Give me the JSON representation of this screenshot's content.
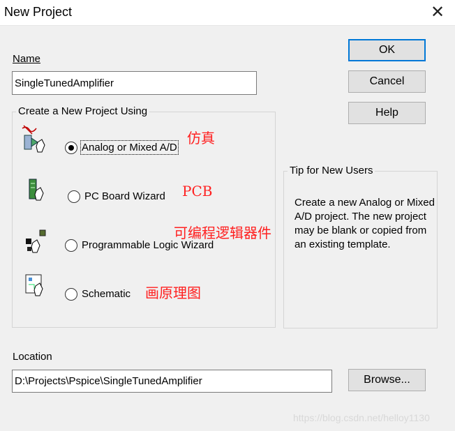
{
  "window": {
    "title": "New Project",
    "close_glyph": "✕"
  },
  "name": {
    "label": "Name",
    "value": "SingleTunedAmplifier"
  },
  "buttons": {
    "ok": "OK",
    "cancel": "Cancel",
    "help": "Help",
    "browse": "Browse..."
  },
  "create_group": {
    "label": "Create a New Project Using",
    "options": [
      {
        "label": "Analog or Mixed A/D",
        "icon": "analog-sim-icon",
        "selected": true,
        "annotation": "仿真"
      },
      {
        "label": "PC Board Wizard",
        "icon": "pc-board-icon",
        "selected": false,
        "annotation": "PCB"
      },
      {
        "label": "Programmable Logic Wizard",
        "icon": "programmable-logic-icon",
        "selected": false,
        "annotation": "可编程逻辑器件"
      },
      {
        "label": "Schematic",
        "icon": "schematic-icon",
        "selected": false,
        "annotation": "画原理图"
      }
    ]
  },
  "tip": {
    "label": "Tip for New Users",
    "text": "Create a new Analog or Mixed A/D project.  The new project may be blank or copied from an existing template."
  },
  "location": {
    "label": "Location",
    "value": "D:\\Projects\\Pspice\\SingleTunedAmplifier"
  },
  "watermark": "https://blog.csdn.net/helloy1130",
  "colors": {
    "focus": "#0078d7",
    "annotation": "#ff2020",
    "window_bg": "#f0f0f0"
  }
}
